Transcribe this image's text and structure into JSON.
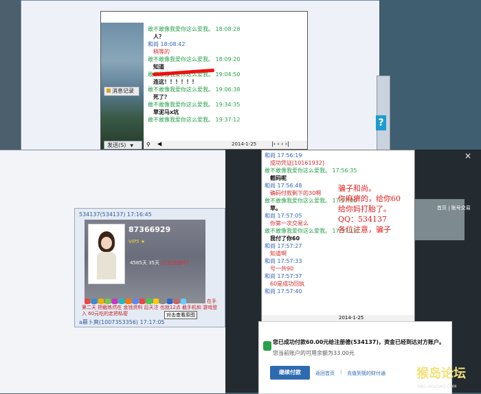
{
  "top_chat": {
    "history_button": "消息记录",
    "send_button": "发送(S)",
    "date": "2014-1-25",
    "messages": [
      {
        "speaker": "敢不敢像我爱你这么爱我。",
        "time": "18:08:28",
        "speaker_color": "gr"
      },
      {
        "text": "人？",
        "style": "bk"
      },
      {
        "speaker": "和尚",
        "time": "18:08:42",
        "speaker_color": "bl"
      },
      {
        "text": "稍等的",
        "style": "rd"
      },
      {
        "speaker": "敢不敢像我爱你这么爱我。",
        "time": "18:09:20",
        "speaker_color": "gr"
      },
      {
        "text": "知道",
        "style": "bk"
      },
      {
        "speaker": "敢不敢像我爱你这么爱我。",
        "time": "19:04:50",
        "speaker_color": "gr"
      },
      {
        "text": "连这！！！！！！",
        "style": "bk"
      },
      {
        "speaker": "敢不敢像我爱你这么爱我。",
        "time": "19:06:38",
        "speaker_color": "gr"
      },
      {
        "text": "死了？",
        "style": "bk"
      },
      {
        "speaker": "敢不敢像我爱你这么爱我。",
        "time": "19:34:35",
        "speaker_color": "gr"
      },
      {
        "text": "草泥马x坑",
        "style": "bk"
      },
      {
        "speaker": "敢不敢像我爱你这么爱我。",
        "time": "19:37:12",
        "speaker_color": "gr"
      }
    ]
  },
  "help_button": "?",
  "profile": {
    "header": "534137(534137) 17:16:45",
    "qq_number": "87366929",
    "days_active": "4585天",
    "days_2": "35天",
    "speed_text": "(正在加速中)",
    "red_text": "第二天  把截练然在  金钱资料  后天注 也就12点 截手机和 游戏登入  60元吃的走把私密",
    "red_text_right": "在手",
    "tooltip": "对击查看原图",
    "footer": "a幕卜爽(1007353356) 17:17:05"
  },
  "bottom_chat": {
    "date": "2014-1-25",
    "messages": [
      {
        "speaker": "和尚",
        "time": "17:56:19",
        "speaker_color": "bl"
      },
      {
        "text": "成功凭证[10161932]",
        "style": "rd"
      },
      {
        "speaker": "敢不敢像我爱你这么爱我。",
        "time": "17:56:35",
        "speaker_color": "gr"
      },
      {
        "text": "截码呢",
        "style": "bk"
      },
      {
        "speaker": "和尚",
        "time": "17:56:48",
        "speaker_color": "bl"
      },
      {
        "text": "确码付款剩下的30啊",
        "style": "rd"
      },
      {
        "speaker": "敢不敢像我爱你这么爱我。",
        "time": "17:57:00",
        "speaker_color": "gr"
      },
      {
        "text": "草。",
        "style": "bk"
      },
      {
        "speaker": "和尚",
        "time": "17:57:05",
        "speaker_color": "bl"
      },
      {
        "text": "你第一次交易么",
        "style": "rd"
      },
      {
        "speaker": "敢不敢像我爱你这么爱我。",
        "time": "17:57:19",
        "speaker_color": "gr"
      },
      {
        "text": "我付了你60",
        "style": "bk"
      },
      {
        "speaker": "和尚",
        "time": "17:57:27",
        "speaker_color": "bl"
      },
      {
        "text": "知道啊",
        "style": "rd"
      },
      {
        "speaker": "和尚",
        "time": "17:57:33",
        "speaker_color": "bl"
      },
      {
        "text": "号一共90",
        "style": "rd"
      },
      {
        "speaker": "和尚",
        "time": "17:57:37",
        "speaker_color": "bl"
      },
      {
        "text": "60是成功回执",
        "style": "rd"
      },
      {
        "speaker": "和尚",
        "time": "17:57:40",
        "speaker_color": "bl"
      }
    ]
  },
  "annotation": [
    "骗子和尚。",
    "你麻痹的，给你60",
    "给你妈打胎了。",
    "QQ：534137",
    "各位注意，骗子"
  ],
  "side_label": "首页 | 账号交易",
  "payment": {
    "main": "您已成功付款60.00元给注册德(534137)，资金已经到达对方账户。",
    "sub": "您当前账户的可用余额为33.00元",
    "button": "继续付款",
    "link_home": "返回首页",
    "separator": "|",
    "link_account": "充值到我的财付通"
  },
  "watermark": "猴岛论坛",
  "watermark_sub": "BBS.HOUDAO.COM",
  "close_label": "×"
}
